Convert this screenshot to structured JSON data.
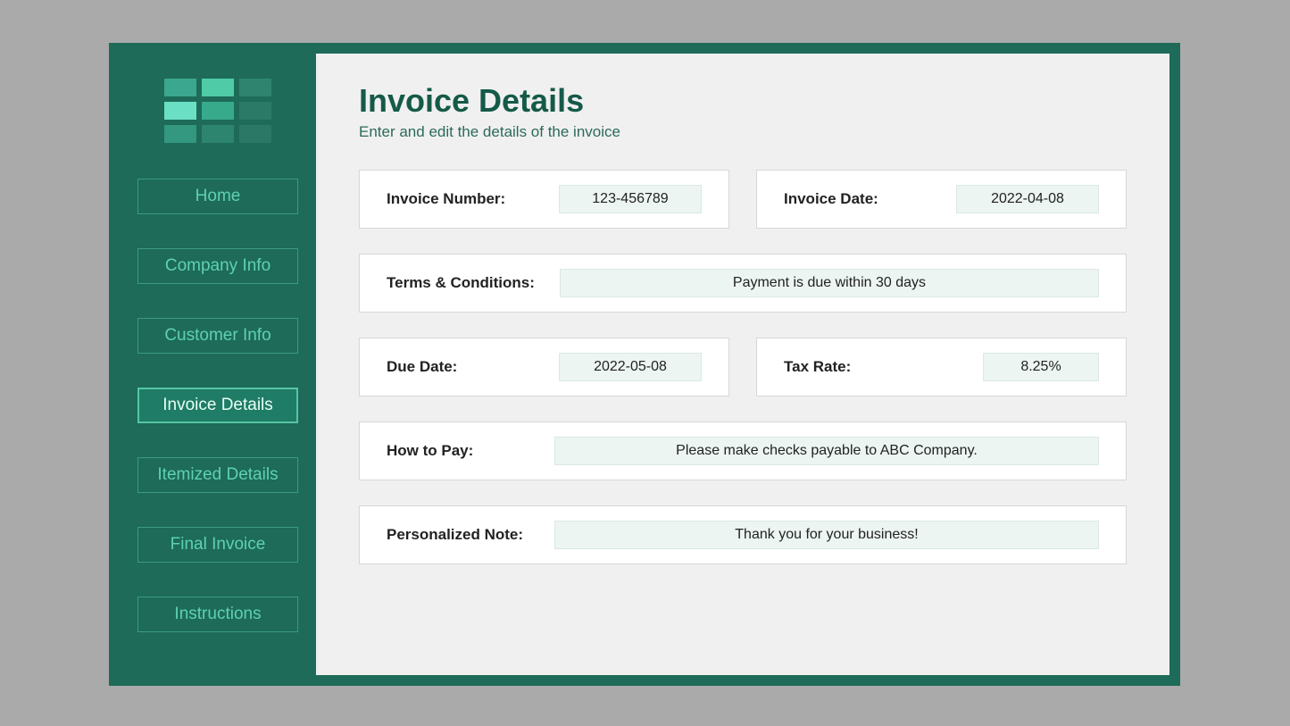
{
  "sidebar": {
    "items": [
      {
        "label": "Home"
      },
      {
        "label": "Company Info"
      },
      {
        "label": "Customer Info"
      },
      {
        "label": "Invoice Details"
      },
      {
        "label": "Itemized Details"
      },
      {
        "label": "Final Invoice"
      },
      {
        "label": "Instructions"
      }
    ],
    "active_index": 3
  },
  "page": {
    "title": "Invoice Details",
    "subtitle": "Enter and edit the details of the invoice"
  },
  "fields": {
    "invoice_number": {
      "label": "Invoice Number:",
      "value": "123-456789"
    },
    "invoice_date": {
      "label": "Invoice Date:",
      "value": "2022-04-08"
    },
    "terms": {
      "label": "Terms & Conditions:",
      "value": "Payment is due within 30 days"
    },
    "due_date": {
      "label": "Due Date:",
      "value": "2022-05-08"
    },
    "tax_rate": {
      "label": "Tax Rate:",
      "value": "8.25%"
    },
    "how_to_pay": {
      "label": "How to Pay:",
      "value": "Please make checks payable to ABC Company."
    },
    "note": {
      "label": "Personalized Note:",
      "value": "Thank you for your business!"
    }
  }
}
